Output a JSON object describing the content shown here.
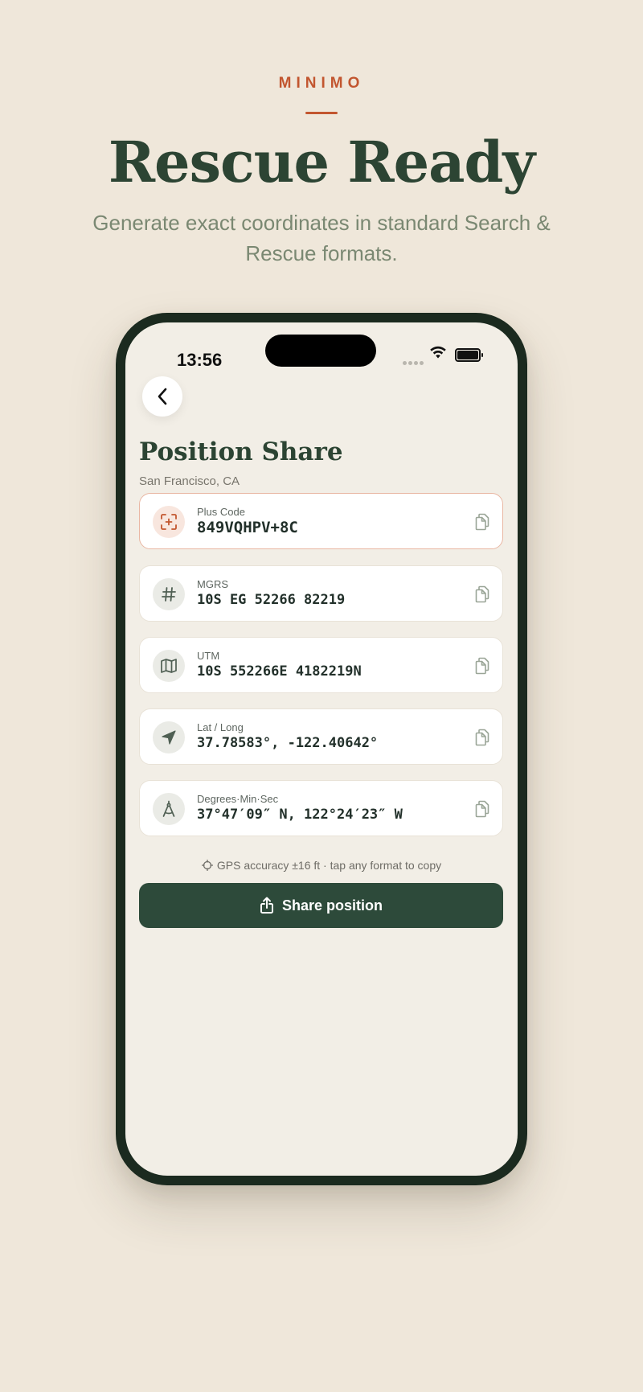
{
  "hero": {
    "brand": "MINIMO",
    "headline": "Rescue Ready",
    "subtitle": "Generate exact coordinates in standard Search & Rescue formats."
  },
  "status_bar": {
    "time": "13:56"
  },
  "screen": {
    "title": "Position Share",
    "location": "San Francisco, CA",
    "formats": [
      {
        "label": "Plus Code",
        "value": "849VQHPV+8C",
        "icon": "plus-code-scan-icon",
        "active": true
      },
      {
        "label": "MGRS",
        "value": "10S EG 52266 82219",
        "icon": "hash-icon",
        "active": false
      },
      {
        "label": "UTM",
        "value": "10S 552266E 4182219N",
        "icon": "map-icon",
        "active": false
      },
      {
        "label": "Lat / Long",
        "value": "37.78583°, -122.40642°",
        "icon": "navigation-arrow-icon",
        "active": false
      },
      {
        "label": "Degrees·Min·Sec",
        "value": "37°47′09″ N, 122°24′23″ W",
        "icon": "compass-icon",
        "active": false
      }
    ],
    "hint": "GPS accuracy ±16 ft · tap any format to copy",
    "share_label": "Share position"
  },
  "colors": {
    "background": "#EFE7DA",
    "accent": "#C2562F",
    "primary": "#2C4433",
    "button": "#2D4A3A"
  }
}
